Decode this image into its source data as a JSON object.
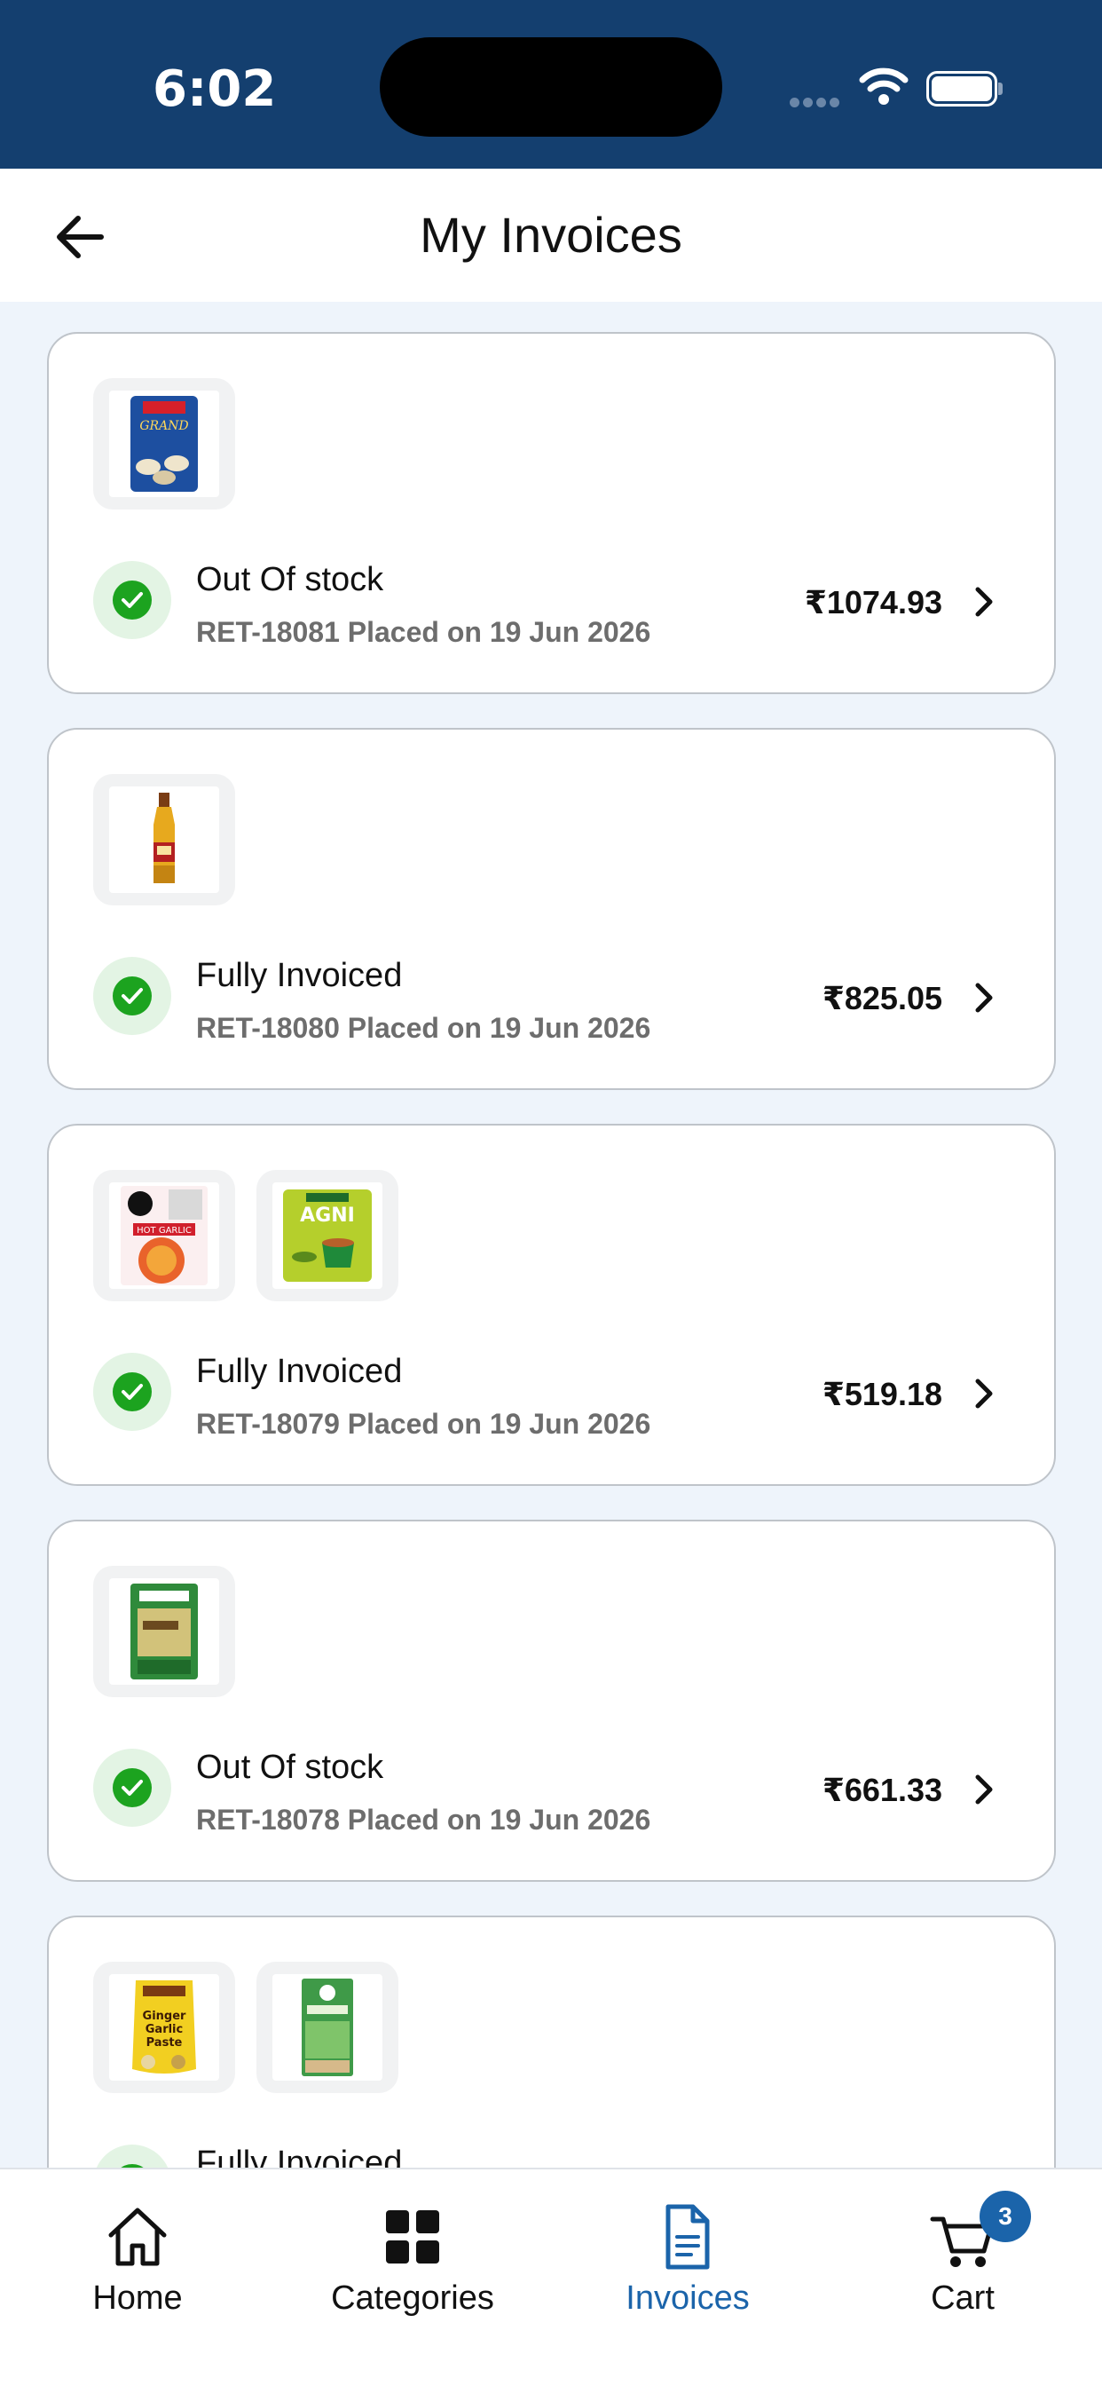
{
  "status_bar": {
    "time": "6:02"
  },
  "header": {
    "title": "My Invoices"
  },
  "invoices": [
    {
      "status": "Out Of stock",
      "meta": "RET-18081 Placed on 19 Jun 2026",
      "amount": "₹1074.93",
      "products": [
        {
          "name": "TATA COFFEE GRAND",
          "color": "#1d4fa0"
        }
      ]
    },
    {
      "status": "Fully Invoiced",
      "meta": "RET-18080 Placed on 19 Jun 2026",
      "amount": "₹825.05",
      "products": [
        {
          "name": "",
          "color": "#d7a126"
        }
      ]
    },
    {
      "status": "Fully Invoiced",
      "meta": "RET-18079 Placed on 19 Jun 2026",
      "amount": "₹519.18",
      "products": [
        {
          "name": "HOT GARLIC",
          "color": "#e84a3c"
        },
        {
          "name": "AGNI",
          "color": "#a8c72c"
        }
      ]
    },
    {
      "status": "Out Of stock",
      "meta": "RET-18078 Placed on 19 Jun 2026",
      "amount": "₹661.33",
      "products": [
        {
          "name": "",
          "color": "#2f8a3b"
        }
      ]
    },
    {
      "status": "Fully Invoiced",
      "meta": "",
      "amount": "",
      "products": [
        {
          "name": "Ginger Garlic Paste",
          "color": "#f2cf21"
        },
        {
          "name": "Tulsi Green Tea",
          "color": "#3f9a48"
        }
      ]
    }
  ],
  "nav": {
    "home": "Home",
    "categories": "Categories",
    "invoices": "Invoices",
    "cart": "Cart",
    "cart_count": "3"
  },
  "colors": {
    "primary": "#1b64aa",
    "header": "#143f6f",
    "success": "#1ca31f"
  }
}
